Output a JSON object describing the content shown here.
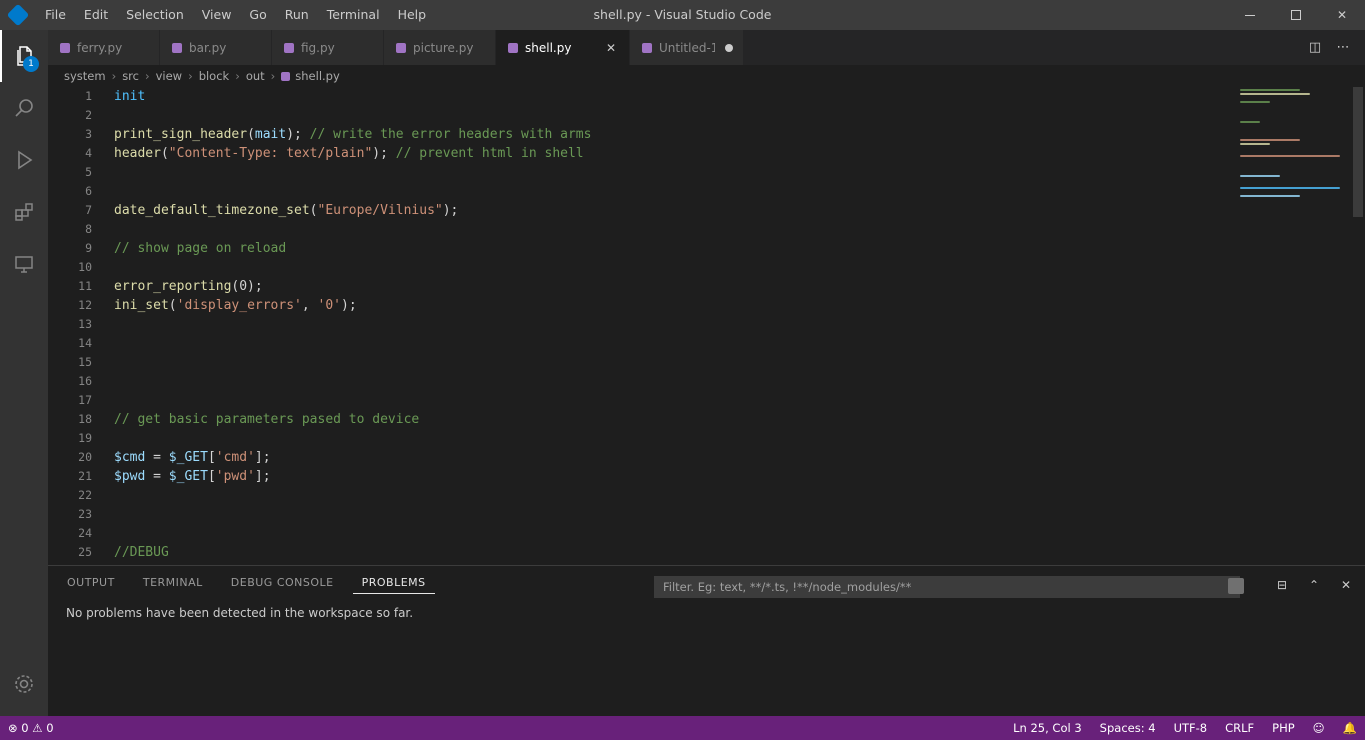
{
  "window": {
    "title": "shell.py - Visual Studio Code",
    "menu": [
      "File",
      "Edit",
      "Selection",
      "View",
      "Go",
      "Run",
      "Terminal",
      "Help"
    ]
  },
  "activity": {
    "items": [
      "explorer",
      "search",
      "run",
      "extensions",
      "remote"
    ],
    "badge": "1"
  },
  "tabs": [
    {
      "label": "ferry.py",
      "active": false
    },
    {
      "label": "bar.py",
      "active": false
    },
    {
      "label": "fig.py",
      "active": false
    },
    {
      "label": "picture.py",
      "active": false
    },
    {
      "label": "shell.py",
      "active": true
    },
    {
      "label": "Untitled-1",
      "active": false,
      "dirty": true
    }
  ],
  "breadcrumb": [
    "system",
    "src",
    "view",
    "block",
    "out",
    "shell.py"
  ],
  "editor": {
    "lines": [
      {
        "no": "1",
        "tokens": [
          {
            "t": "init",
            "c": "tok-kw"
          }
        ]
      },
      {
        "no": "2",
        "tokens": []
      },
      {
        "no": "3",
        "tokens": [
          {
            "t": "print_sign_header",
            "c": "tok-fn"
          },
          {
            "t": "(",
            "c": "tok-pl"
          },
          {
            "t": "mait",
            "c": "tok-var"
          },
          {
            "t": ");",
            "c": "tok-pl"
          },
          {
            "t": " // write the error headers with arms",
            "c": "tok-cm"
          }
        ]
      },
      {
        "no": "4",
        "tokens": [
          {
            "t": "header",
            "c": "tok-fn"
          },
          {
            "t": "(",
            "c": "tok-pl"
          },
          {
            "t": "\"Content-Type: text/plain\"",
            "c": "tok-str"
          },
          {
            "t": ");",
            "c": "tok-pl"
          },
          {
            "t": " // prevent html in shell",
            "c": "tok-cm"
          }
        ]
      },
      {
        "no": "5",
        "tokens": []
      },
      {
        "no": "6",
        "tokens": []
      },
      {
        "no": "7",
        "tokens": [
          {
            "t": "date_default_timezone_set",
            "c": "tok-fn"
          },
          {
            "t": "(",
            "c": "tok-pl"
          },
          {
            "t": "\"Europe/Vilnius\"",
            "c": "tok-str"
          },
          {
            "t": ");",
            "c": "tok-pl"
          }
        ]
      },
      {
        "no": "8",
        "tokens": []
      },
      {
        "no": "9",
        "tokens": [
          {
            "t": "// show page on reload",
            "c": "tok-cm"
          }
        ]
      },
      {
        "no": "10",
        "tokens": []
      },
      {
        "no": "11",
        "tokens": [
          {
            "t": "error_reporting",
            "c": "tok-fn"
          },
          {
            "t": "(0);",
            "c": "tok-pl"
          }
        ]
      },
      {
        "no": "12",
        "tokens": [
          {
            "t": "ini_set",
            "c": "tok-fn"
          },
          {
            "t": "(",
            "c": "tok-pl"
          },
          {
            "t": "'display_errors'",
            "c": "tok-str"
          },
          {
            "t": ", ",
            "c": "tok-pl"
          },
          {
            "t": "'0'",
            "c": "tok-str"
          },
          {
            "t": ");",
            "c": "tok-pl"
          }
        ]
      },
      {
        "no": "13",
        "tokens": []
      },
      {
        "no": "14",
        "tokens": []
      },
      {
        "no": "15",
        "tokens": []
      },
      {
        "no": "16",
        "tokens": []
      },
      {
        "no": "17",
        "tokens": []
      },
      {
        "no": "18",
        "tokens": [
          {
            "t": "// get basic parameters pased to device",
            "c": "tok-cm"
          }
        ]
      },
      {
        "no": "19",
        "tokens": []
      },
      {
        "no": "20",
        "tokens": [
          {
            "t": "$cmd",
            "c": "tok-var"
          },
          {
            "t": " = ",
            "c": "tok-pl"
          },
          {
            "t": "$_GET",
            "c": "tok-var"
          },
          {
            "t": "[",
            "c": "tok-pl"
          },
          {
            "t": "'cmd'",
            "c": "tok-str"
          },
          {
            "t": "];",
            "c": "tok-pl"
          }
        ]
      },
      {
        "no": "21",
        "tokens": [
          {
            "t": "$pwd",
            "c": "tok-var"
          },
          {
            "t": " = ",
            "c": "tok-pl"
          },
          {
            "t": "$_GET",
            "c": "tok-var"
          },
          {
            "t": "[",
            "c": "tok-pl"
          },
          {
            "t": "'pwd'",
            "c": "tok-str"
          },
          {
            "t": "];",
            "c": "tok-pl"
          }
        ]
      },
      {
        "no": "22",
        "tokens": []
      },
      {
        "no": "23",
        "tokens": []
      },
      {
        "no": "24",
        "tokens": []
      },
      {
        "no": "25",
        "tokens": [
          {
            "t": "//DEBUG",
            "c": "tok-cm"
          }
        ]
      }
    ]
  },
  "panel": {
    "tabs": [
      "OUTPUT",
      "TERMINAL",
      "DEBUG CONSOLE",
      "PROBLEMS"
    ],
    "active_tab": "PROBLEMS",
    "filter_placeholder": "Filter. Eg: text, **/*.ts, !**/node_modules/**",
    "message": "No problems have been detected in the workspace so far."
  },
  "status": {
    "left": "⊗ 0  ⚠ 0",
    "right": [
      "Ln 25, Col 3",
      "Spaces: 4",
      "UTF-8",
      "CRLF",
      "PHP",
      "☺",
      "🔔"
    ]
  }
}
